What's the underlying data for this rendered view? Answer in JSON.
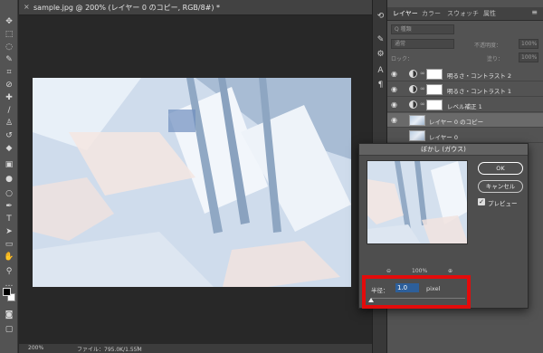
{
  "document": {
    "tab_close": "×",
    "tab_title": "sample.jpg @ 200% (レイヤー 0 のコピー, RGB/8#) *"
  },
  "status": {
    "zoom": "200%",
    "file": "ファイル：795.0K/1.55M",
    "arrow": "›"
  },
  "panel": {
    "tabs": [
      "レイヤー",
      "カラー",
      "スウォッチ",
      "属性"
    ],
    "menu": "≡",
    "search": "Q 種類",
    "mode": "通常",
    "opacity_label": "不透明度：",
    "opacity_value": "100%",
    "lock_label": "ロック：",
    "fill_label": "塗り：",
    "fill_value": "100%",
    "layers": [
      {
        "name": "明るさ・コントラスト 2",
        "type": "adjustment"
      },
      {
        "name": "明るさ・コントラスト 1",
        "type": "adjustment"
      },
      {
        "name": "レベル補正 1",
        "type": "adjustment"
      },
      {
        "name": "レイヤー 0 のコピー",
        "type": "image",
        "selected": true
      },
      {
        "name": "レイヤー 0",
        "type": "image"
      }
    ]
  },
  "dialog": {
    "title": "ぼかし (ガウス)",
    "ok_label": "OK",
    "cancel_label": "キャンセル",
    "preview_label": "プレビュー",
    "preview_checked": true,
    "zoom_minus": "⊖",
    "zoom_value": "100%",
    "zoom_plus": "⊕",
    "radius_label": "半径：",
    "radius_value": "1.0",
    "radius_unit": "pixel",
    "radius_slider_fraction": 0.0,
    "highlight_color": "#e30b0b"
  },
  "icons": {
    "tools": [
      "move-icon",
      "marquee-icon",
      "lasso-icon",
      "quick-select-icon",
      "crop-icon",
      "eyedropper-icon",
      "healing-icon",
      "brush-icon",
      "stamp-icon",
      "history-brush-icon",
      "eraser-icon",
      "gradient-icon",
      "blur-icon",
      "dodge-icon",
      "pen-icon",
      "type-icon",
      "path-select-icon",
      "shape-icon",
      "hand-icon",
      "zoom-icon"
    ]
  }
}
